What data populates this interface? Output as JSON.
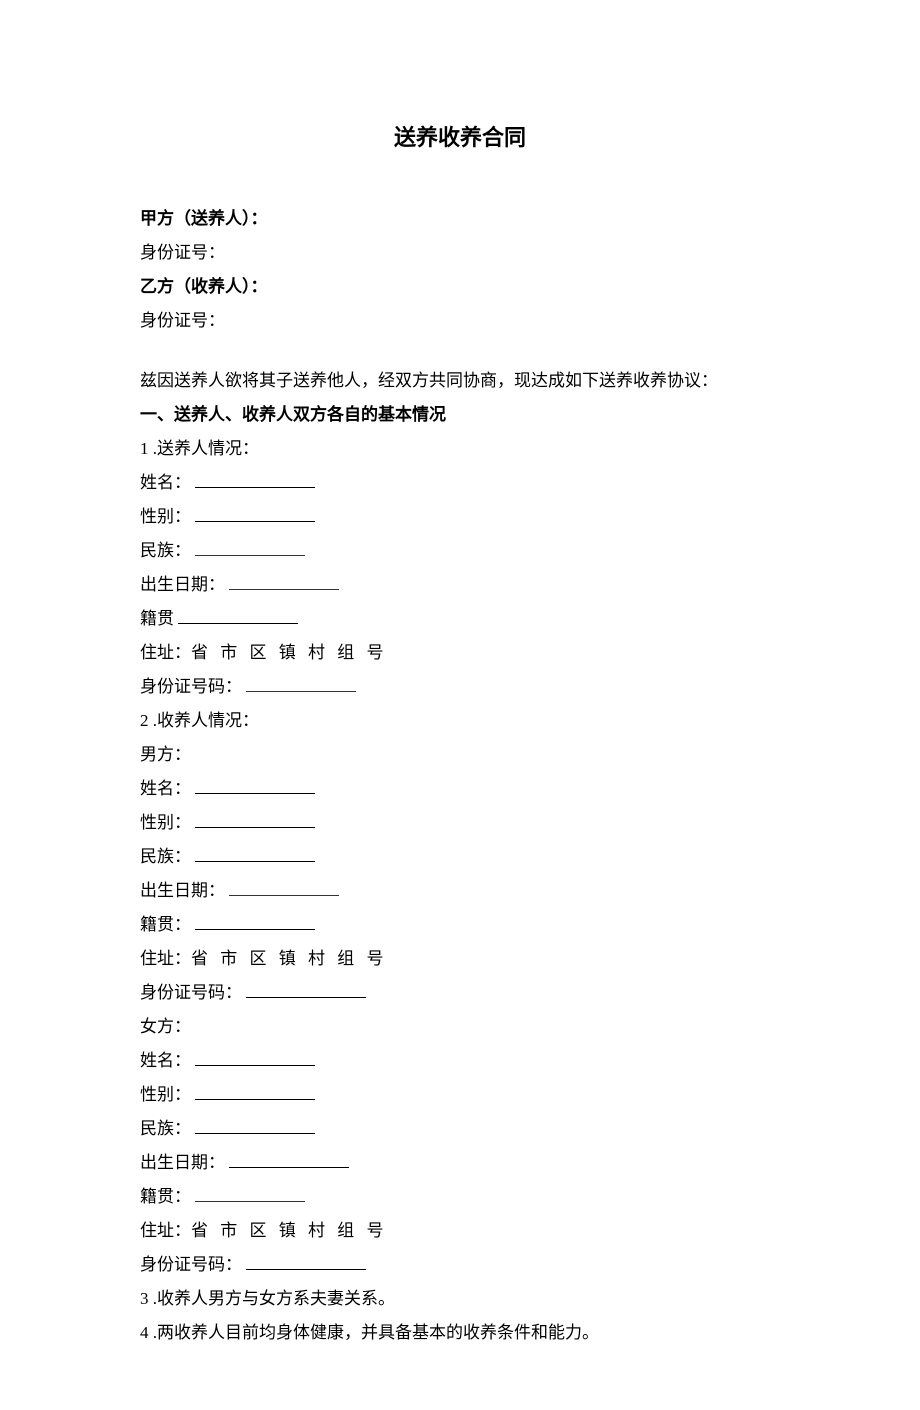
{
  "title": "送养收养合同",
  "party_a_label": "甲方（送养人）：",
  "id_label": "身份证号：",
  "party_b_label": "乙方（收养人）：",
  "preamble": "兹因送养人欲将其子送养他人，经双方共同协商，现达成如下送养收养协议：",
  "section1_heading": "一、送养人、收养人双方各自的基本情况",
  "item1_label": "1 .送养人情况：",
  "name_label": "姓名：",
  "gender_label": "性别：",
  "ethnicity_label": "民族：",
  "dob_label": "出生日期：",
  "origin_label": "籍贯",
  "origin_label_colon": "籍贯：",
  "address_prefix": "住址：",
  "address_parts": "省 市 区 镇 村 组 号",
  "idnum_label": "身份证号码：",
  "item2_label": "2 .收养人情况：",
  "male_label": "男方：",
  "female_label": "女方：",
  "item3_text": "3 .收养人男方与女方系夫妻关系。",
  "item4_text": "4 .两收养人目前均身体健康，并具备基本的收养条件和能力。"
}
